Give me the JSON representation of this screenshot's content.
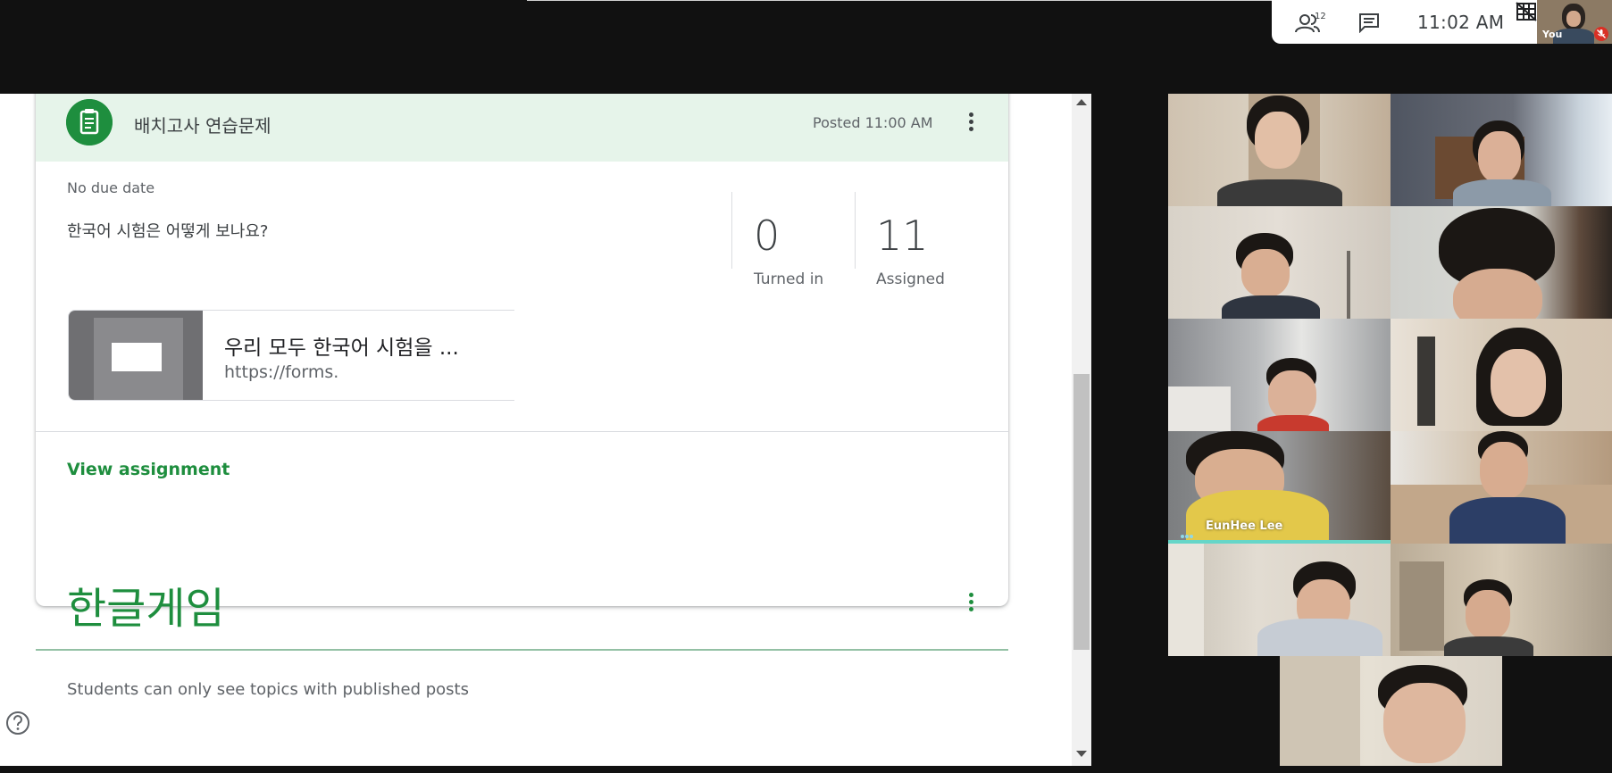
{
  "meet": {
    "participant_count": "12",
    "time": "11:02  AM",
    "self_label": "You",
    "icons": [
      "people-icon",
      "chat-icon",
      "layout-icon",
      "mic-off-icon"
    ]
  },
  "classroom": {
    "assignment": {
      "title": "배치고사 연습문제",
      "posted": "Posted 11:00 AM",
      "due": "No due date",
      "question": "한국어 시험은 어떻게 보나요?",
      "turned_in_count": "0",
      "turned_in_label": "Turned in",
      "assigned_count": "11",
      "assigned_label": "Assigned",
      "attachment_title": "우리 모두 한국어 시험을 ...",
      "attachment_url": "https://forms.",
      "view_link": "View assignment"
    },
    "topic": {
      "title": "한글게임",
      "note": "Students can only see topics with published posts"
    },
    "colors": {
      "accent_green": "#1e8e3e",
      "header_tint": "#e6f4ea"
    }
  },
  "participants": [
    {
      "name": ""
    },
    {
      "name": ""
    },
    {
      "name": ""
    },
    {
      "name": ""
    },
    {
      "name": ""
    },
    {
      "name": ""
    },
    {
      "name": "EunHee Lee",
      "speaking": true
    },
    {
      "name": ""
    },
    {
      "name": ""
    },
    {
      "name": ""
    },
    {
      "name": ""
    }
  ]
}
